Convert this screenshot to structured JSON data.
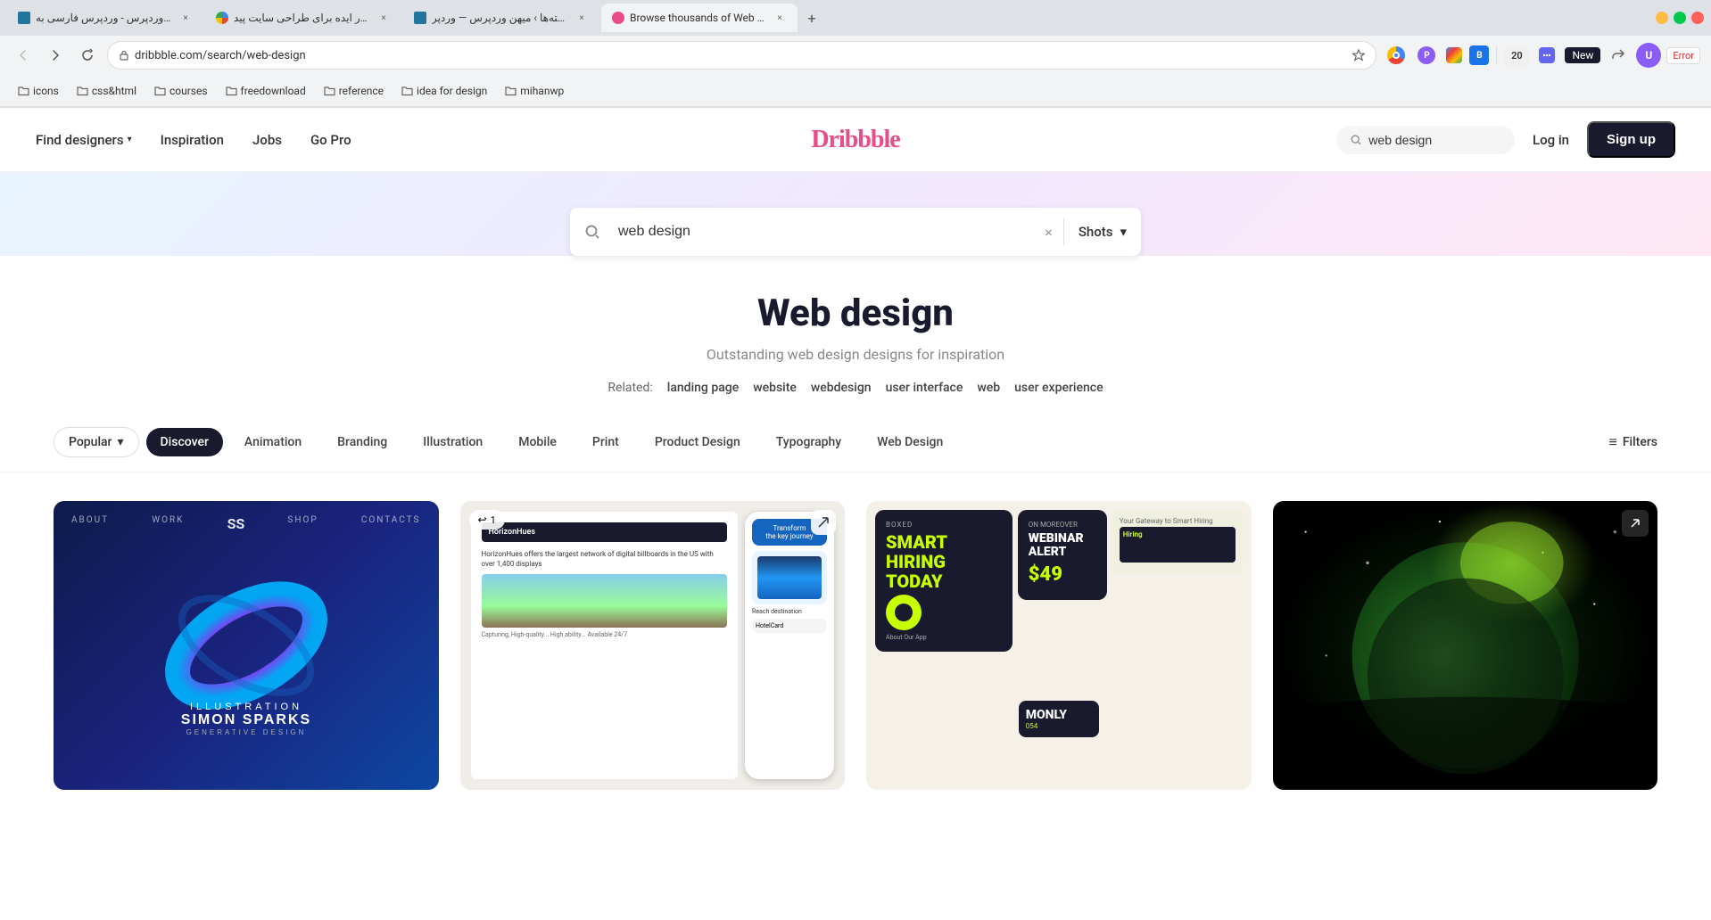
{
  "browser": {
    "tabs": [
      {
        "id": "tab1",
        "favicon_color": "#21759b",
        "title": "میهن وردپرس - وردپرس فارسی به",
        "active": false,
        "closeable": true
      },
      {
        "id": "tab2",
        "favicon_color": "#4285f4",
        "title": "چطور ایده برای طراحی سایت پید",
        "active": false,
        "closeable": true
      },
      {
        "id": "tab3",
        "favicon_color": "#21759b",
        "title": "نوشته‌ها › میهن وردپرس — وردپر",
        "active": false,
        "closeable": true
      },
      {
        "id": "tab4",
        "favicon_color": "#ea4c89",
        "title": "Browse thousands of Web Des...",
        "active": true,
        "closeable": true
      }
    ],
    "address": "dribbble.com/search/web-design",
    "new_tab_label": "New"
  },
  "bookmarks": [
    {
      "label": "icons"
    },
    {
      "label": "css&html"
    },
    {
      "label": "courses"
    },
    {
      "label": "freedownload"
    },
    {
      "label": "reference"
    },
    {
      "label": "idea for design"
    },
    {
      "label": "mihanwp"
    }
  ],
  "navbar": {
    "find_designers_label": "Find designers",
    "inspiration_label": "Inspiration",
    "jobs_label": "Jobs",
    "go_pro_label": "Go Pro",
    "logo_text": "Dribbble",
    "search_placeholder": "web design",
    "login_label": "Log in",
    "signup_label": "Sign up"
  },
  "hero": {
    "search_value": "web design",
    "search_type": "Shots",
    "clear_icon": "×",
    "chevron_icon": "▾"
  },
  "page_content": {
    "title": "Web design",
    "subtitle": "Outstanding web design designs for inspiration",
    "related_label": "Related:",
    "related_tags": [
      "landing page",
      "website",
      "webdesign",
      "user interface",
      "web",
      "user experience"
    ]
  },
  "filter_bar": {
    "popular_label": "Popular",
    "chevron": "▾",
    "filters": [
      {
        "label": "Discover",
        "active": true
      },
      {
        "label": "Animation",
        "active": false
      },
      {
        "label": "Branding",
        "active": false
      },
      {
        "label": "Illustration",
        "active": false
      },
      {
        "label": "Mobile",
        "active": false
      },
      {
        "label": "Print",
        "active": false
      },
      {
        "label": "Product Design",
        "active": false
      },
      {
        "label": "Typography",
        "active": false
      },
      {
        "label": "Web Design",
        "active": false
      }
    ],
    "filters_btn_label": "Filters",
    "filter_icon": "≡"
  },
  "shots": [
    {
      "id": "shot1",
      "style": "dark-blue",
      "has_overlay": false
    },
    {
      "id": "shot2",
      "style": "website",
      "has_overlay": true,
      "like_count": "1"
    },
    {
      "id": "shot3",
      "style": "hiring",
      "has_overlay": false
    },
    {
      "id": "shot4",
      "style": "space",
      "has_overlay": false,
      "has_link": true
    }
  ],
  "icons": {
    "search": "🔍",
    "filter_lines": "≡",
    "chevron_down": "▾",
    "close": "×",
    "bookmark": "📁",
    "star": "☆",
    "heart": "♡",
    "reply": "↩",
    "link": "↗"
  }
}
